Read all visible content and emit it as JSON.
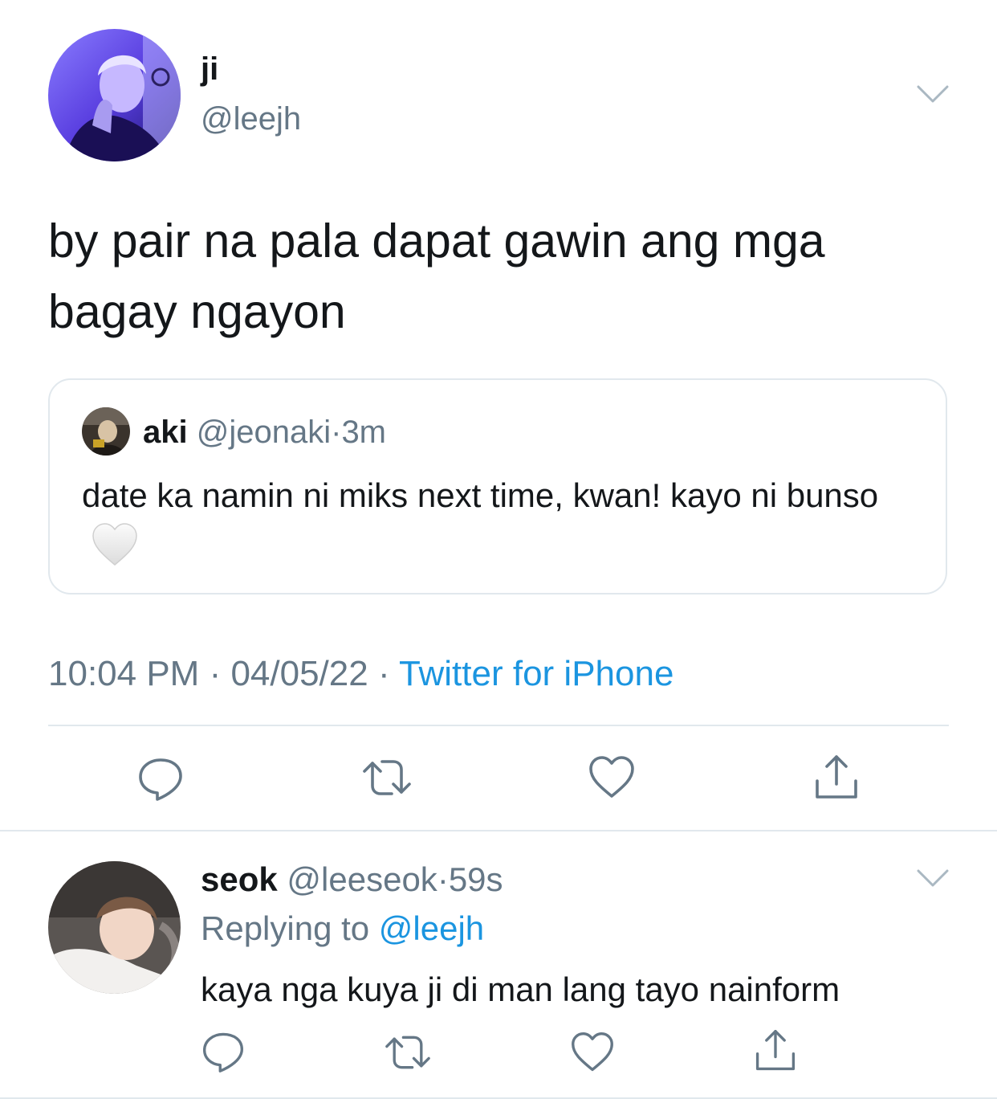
{
  "tweet": {
    "author_name": "ji",
    "author_handle": "@leejh",
    "text": "by pair na pala dapat gawin ang mga bagay ngayon",
    "quote": {
      "author_name": "aki",
      "author_handle": "@jeonaki",
      "separator": "·",
      "time": "3m",
      "text": "date ka namin ni miks next time, kwan! kayo ni bunso",
      "emoji": "white-heart-icon"
    },
    "meta": {
      "time": "10:04 PM",
      "sep1": " · ",
      "date": "04/05/22",
      "sep2": " · ",
      "source": "Twitter for iPhone"
    },
    "actions": [
      "reply-icon",
      "retweet-icon",
      "like-icon",
      "share-icon"
    ]
  },
  "reply": {
    "author_name": "seok",
    "author_handle": "@leeseok",
    "separator": "·",
    "time": "59s",
    "replying_label": "Replying to",
    "replying_mention": "@leejh",
    "text": "kaya nga kuya ji di man lang tayo nainform",
    "actions": [
      "reply-icon",
      "retweet-icon",
      "like-icon",
      "share-icon"
    ]
  },
  "colors": {
    "text": "#14171a",
    "secondary": "#657786",
    "link": "#1b95e0",
    "divider": "#e1e8ed",
    "icon": "#657786"
  }
}
